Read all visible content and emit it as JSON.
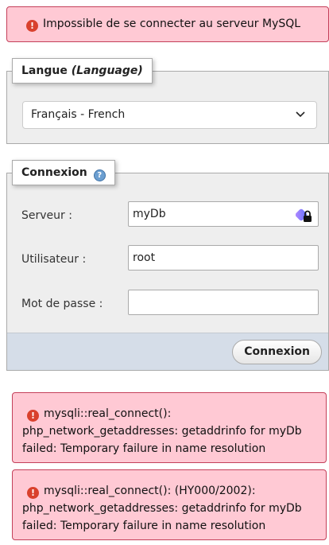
{
  "top_error": {
    "message": "Impossible de se connecter au serveur MySQL"
  },
  "language": {
    "legend": "Langue ",
    "legend_em": "(Language)",
    "selected": "Français - French"
  },
  "login": {
    "legend": "Connexion",
    "server_label": "Serveur :",
    "server_value": "myDb",
    "user_label": "Utilisateur :",
    "user_value": "root",
    "password_label": "Mot de passe :",
    "password_value": "",
    "submit_label": "Connexion"
  },
  "errors": [
    {
      "text": "mysqli::real_connect(): php_network_getaddresses: getaddrinfo for myDb failed: Temporary failure in name resolution"
    },
    {
      "text": "mysqli::real_connect(): (HY000/2002): php_network_getaddresses: getaddrinfo for myDb failed: Temporary failure in name resolution"
    }
  ],
  "colors": {
    "error_bg": "#ffc9d4",
    "error_border": "#c4405a",
    "panel_bg": "#eeeeee",
    "footer_bg": "#d5dde8"
  },
  "icons": {
    "error": "error-circle-icon",
    "help": "help-icon",
    "dropdown": "chevron-down-icon",
    "password_manager": "password-manager-lock-icon"
  }
}
